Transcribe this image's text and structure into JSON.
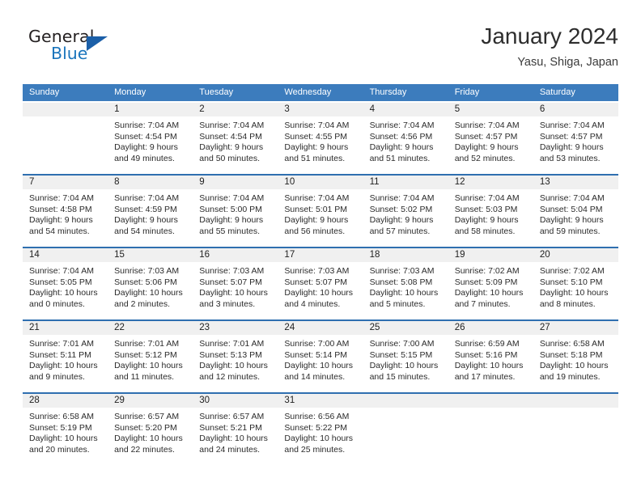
{
  "brand": {
    "name_part1": "General",
    "name_part2": "Blue",
    "logo_icon": "triangle-logo-icon"
  },
  "header": {
    "title": "January 2024",
    "location": "Yasu, Shiga, Japan"
  },
  "weekdays": [
    "Sunday",
    "Monday",
    "Tuesday",
    "Wednesday",
    "Thursday",
    "Friday",
    "Saturday"
  ],
  "colors": {
    "header_blue": "#3c7cbd",
    "row_divider_blue": "#2f6fb0",
    "day_band_gray": "#f0f0f0",
    "brand_blue": "#1b75bc",
    "logo_blue": "#1b5fa8"
  },
  "weeks": [
    [
      {
        "day": "",
        "empty": true,
        "lines": []
      },
      {
        "day": "1",
        "empty": false,
        "lines": [
          "Sunrise: 7:04 AM",
          "Sunset: 4:54 PM",
          "Daylight: 9 hours",
          "and 49 minutes."
        ]
      },
      {
        "day": "2",
        "empty": false,
        "lines": [
          "Sunrise: 7:04 AM",
          "Sunset: 4:54 PM",
          "Daylight: 9 hours",
          "and 50 minutes."
        ]
      },
      {
        "day": "3",
        "empty": false,
        "lines": [
          "Sunrise: 7:04 AM",
          "Sunset: 4:55 PM",
          "Daylight: 9 hours",
          "and 51 minutes."
        ]
      },
      {
        "day": "4",
        "empty": false,
        "lines": [
          "Sunrise: 7:04 AM",
          "Sunset: 4:56 PM",
          "Daylight: 9 hours",
          "and 51 minutes."
        ]
      },
      {
        "day": "5",
        "empty": false,
        "lines": [
          "Sunrise: 7:04 AM",
          "Sunset: 4:57 PM",
          "Daylight: 9 hours",
          "and 52 minutes."
        ]
      },
      {
        "day": "6",
        "empty": false,
        "lines": [
          "Sunrise: 7:04 AM",
          "Sunset: 4:57 PM",
          "Daylight: 9 hours",
          "and 53 minutes."
        ]
      }
    ],
    [
      {
        "day": "7",
        "empty": false,
        "lines": [
          "Sunrise: 7:04 AM",
          "Sunset: 4:58 PM",
          "Daylight: 9 hours",
          "and 54 minutes."
        ]
      },
      {
        "day": "8",
        "empty": false,
        "lines": [
          "Sunrise: 7:04 AM",
          "Sunset: 4:59 PM",
          "Daylight: 9 hours",
          "and 54 minutes."
        ]
      },
      {
        "day": "9",
        "empty": false,
        "lines": [
          "Sunrise: 7:04 AM",
          "Sunset: 5:00 PM",
          "Daylight: 9 hours",
          "and 55 minutes."
        ]
      },
      {
        "day": "10",
        "empty": false,
        "lines": [
          "Sunrise: 7:04 AM",
          "Sunset: 5:01 PM",
          "Daylight: 9 hours",
          "and 56 minutes."
        ]
      },
      {
        "day": "11",
        "empty": false,
        "lines": [
          "Sunrise: 7:04 AM",
          "Sunset: 5:02 PM",
          "Daylight: 9 hours",
          "and 57 minutes."
        ]
      },
      {
        "day": "12",
        "empty": false,
        "lines": [
          "Sunrise: 7:04 AM",
          "Sunset: 5:03 PM",
          "Daylight: 9 hours",
          "and 58 minutes."
        ]
      },
      {
        "day": "13",
        "empty": false,
        "lines": [
          "Sunrise: 7:04 AM",
          "Sunset: 5:04 PM",
          "Daylight: 9 hours",
          "and 59 minutes."
        ]
      }
    ],
    [
      {
        "day": "14",
        "empty": false,
        "lines": [
          "Sunrise: 7:04 AM",
          "Sunset: 5:05 PM",
          "Daylight: 10 hours",
          "and 0 minutes."
        ]
      },
      {
        "day": "15",
        "empty": false,
        "lines": [
          "Sunrise: 7:03 AM",
          "Sunset: 5:06 PM",
          "Daylight: 10 hours",
          "and 2 minutes."
        ]
      },
      {
        "day": "16",
        "empty": false,
        "lines": [
          "Sunrise: 7:03 AM",
          "Sunset: 5:07 PM",
          "Daylight: 10 hours",
          "and 3 minutes."
        ]
      },
      {
        "day": "17",
        "empty": false,
        "lines": [
          "Sunrise: 7:03 AM",
          "Sunset: 5:07 PM",
          "Daylight: 10 hours",
          "and 4 minutes."
        ]
      },
      {
        "day": "18",
        "empty": false,
        "lines": [
          "Sunrise: 7:03 AM",
          "Sunset: 5:08 PM",
          "Daylight: 10 hours",
          "and 5 minutes."
        ]
      },
      {
        "day": "19",
        "empty": false,
        "lines": [
          "Sunrise: 7:02 AM",
          "Sunset: 5:09 PM",
          "Daylight: 10 hours",
          "and 7 minutes."
        ]
      },
      {
        "day": "20",
        "empty": false,
        "lines": [
          "Sunrise: 7:02 AM",
          "Sunset: 5:10 PM",
          "Daylight: 10 hours",
          "and 8 minutes."
        ]
      }
    ],
    [
      {
        "day": "21",
        "empty": false,
        "lines": [
          "Sunrise: 7:01 AM",
          "Sunset: 5:11 PM",
          "Daylight: 10 hours",
          "and 9 minutes."
        ]
      },
      {
        "day": "22",
        "empty": false,
        "lines": [
          "Sunrise: 7:01 AM",
          "Sunset: 5:12 PM",
          "Daylight: 10 hours",
          "and 11 minutes."
        ]
      },
      {
        "day": "23",
        "empty": false,
        "lines": [
          "Sunrise: 7:01 AM",
          "Sunset: 5:13 PM",
          "Daylight: 10 hours",
          "and 12 minutes."
        ]
      },
      {
        "day": "24",
        "empty": false,
        "lines": [
          "Sunrise: 7:00 AM",
          "Sunset: 5:14 PM",
          "Daylight: 10 hours",
          "and 14 minutes."
        ]
      },
      {
        "day": "25",
        "empty": false,
        "lines": [
          "Sunrise: 7:00 AM",
          "Sunset: 5:15 PM",
          "Daylight: 10 hours",
          "and 15 minutes."
        ]
      },
      {
        "day": "26",
        "empty": false,
        "lines": [
          "Sunrise: 6:59 AM",
          "Sunset: 5:16 PM",
          "Daylight: 10 hours",
          "and 17 minutes."
        ]
      },
      {
        "day": "27",
        "empty": false,
        "lines": [
          "Sunrise: 6:58 AM",
          "Sunset: 5:18 PM",
          "Daylight: 10 hours",
          "and 19 minutes."
        ]
      }
    ],
    [
      {
        "day": "28",
        "empty": false,
        "lines": [
          "Sunrise: 6:58 AM",
          "Sunset: 5:19 PM",
          "Daylight: 10 hours",
          "and 20 minutes."
        ]
      },
      {
        "day": "29",
        "empty": false,
        "lines": [
          "Sunrise: 6:57 AM",
          "Sunset: 5:20 PM",
          "Daylight: 10 hours",
          "and 22 minutes."
        ]
      },
      {
        "day": "30",
        "empty": false,
        "lines": [
          "Sunrise: 6:57 AM",
          "Sunset: 5:21 PM",
          "Daylight: 10 hours",
          "and 24 minutes."
        ]
      },
      {
        "day": "31",
        "empty": false,
        "lines": [
          "Sunrise: 6:56 AM",
          "Sunset: 5:22 PM",
          "Daylight: 10 hours",
          "and 25 minutes."
        ]
      },
      {
        "day": "",
        "empty": true,
        "lines": []
      },
      {
        "day": "",
        "empty": true,
        "lines": []
      },
      {
        "day": "",
        "empty": true,
        "lines": []
      }
    ]
  ]
}
